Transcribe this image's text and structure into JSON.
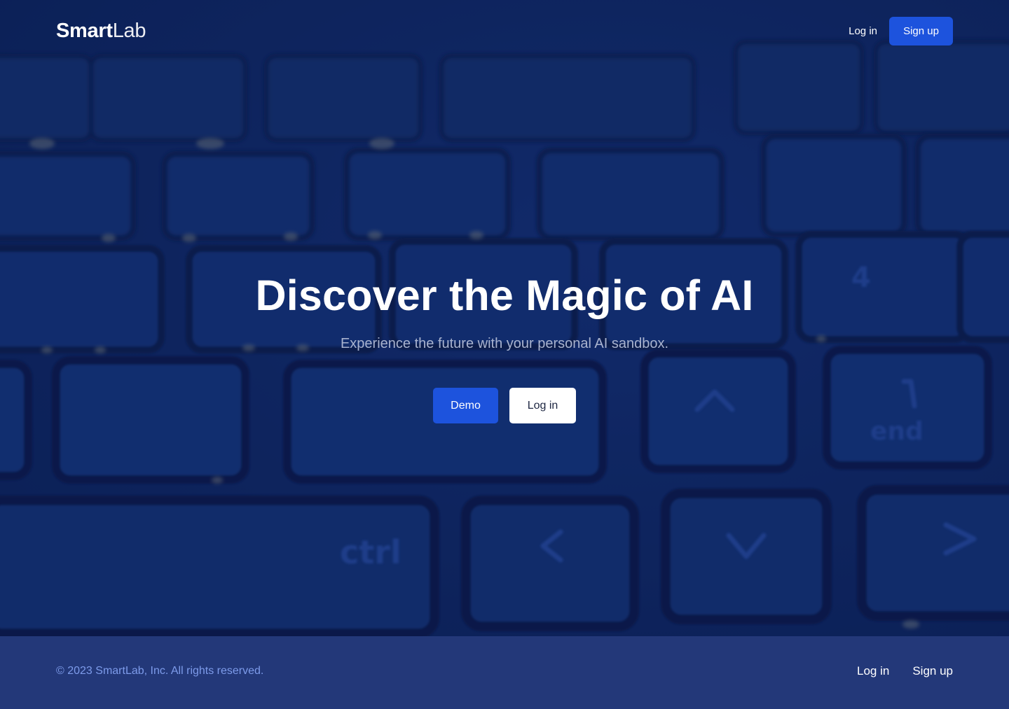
{
  "brand": {
    "name_bold": "Smart",
    "name_light": "Lab"
  },
  "header": {
    "login_label": "Log in",
    "signup_label": "Sign up"
  },
  "hero": {
    "title": "Discover the Magic of AI",
    "subtitle": "Experience the future with your personal AI sandbox.",
    "demo_label": "Demo",
    "login_label": "Log in"
  },
  "footer": {
    "copyright": "© 2023 SmartLab, Inc. All rights reserved.",
    "login_label": "Log in",
    "signup_label": "Sign up"
  },
  "colors": {
    "primary": "#1d53dd",
    "hero_bg": "#122a68",
    "footer_bg": "#233879",
    "footer_text": "#7d9bea"
  }
}
